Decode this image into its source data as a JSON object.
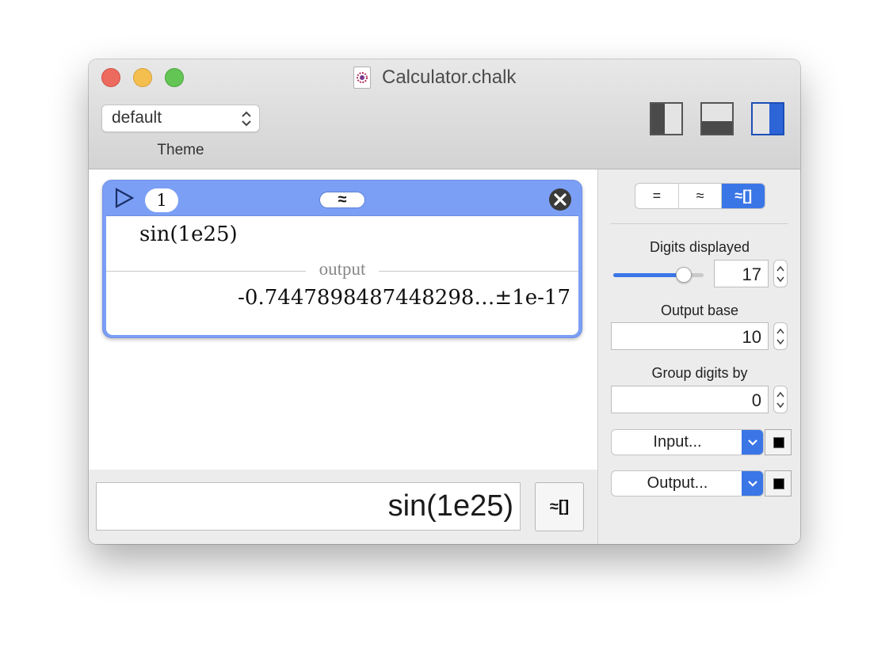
{
  "window": {
    "title": "Calculator.chalk"
  },
  "toolbar": {
    "theme_value": "default",
    "theme_label": "Theme",
    "layout_buttons": [
      "layout-left-panel",
      "layout-bottom-panel",
      "layout-right-panel"
    ],
    "active_layout": "layout-right-panel"
  },
  "entry": {
    "number": "1",
    "mode_badge": "≈",
    "input": "sin(1e25)",
    "output_label": "output",
    "output_value": "-0.7447898487448298…±1e-17"
  },
  "input_bar": {
    "expression": "sin(1e25)",
    "mode_button": "≈[]"
  },
  "panel": {
    "modes": [
      "=",
      "≈",
      "≈[]"
    ],
    "active_mode": "≈[]",
    "digits_label": "Digits displayed",
    "digits_value": "17",
    "digits_slider_fraction": 0.78,
    "base_label": "Output base",
    "base_value": "10",
    "group_label": "Group digits by",
    "group_value": "0",
    "input_font_label": "Input...",
    "output_font_label": "Output...",
    "input_color": "#000000",
    "output_color": "#000000"
  },
  "colors": {
    "accent": "#3b76e7",
    "entry_header": "#7b9ff5"
  }
}
